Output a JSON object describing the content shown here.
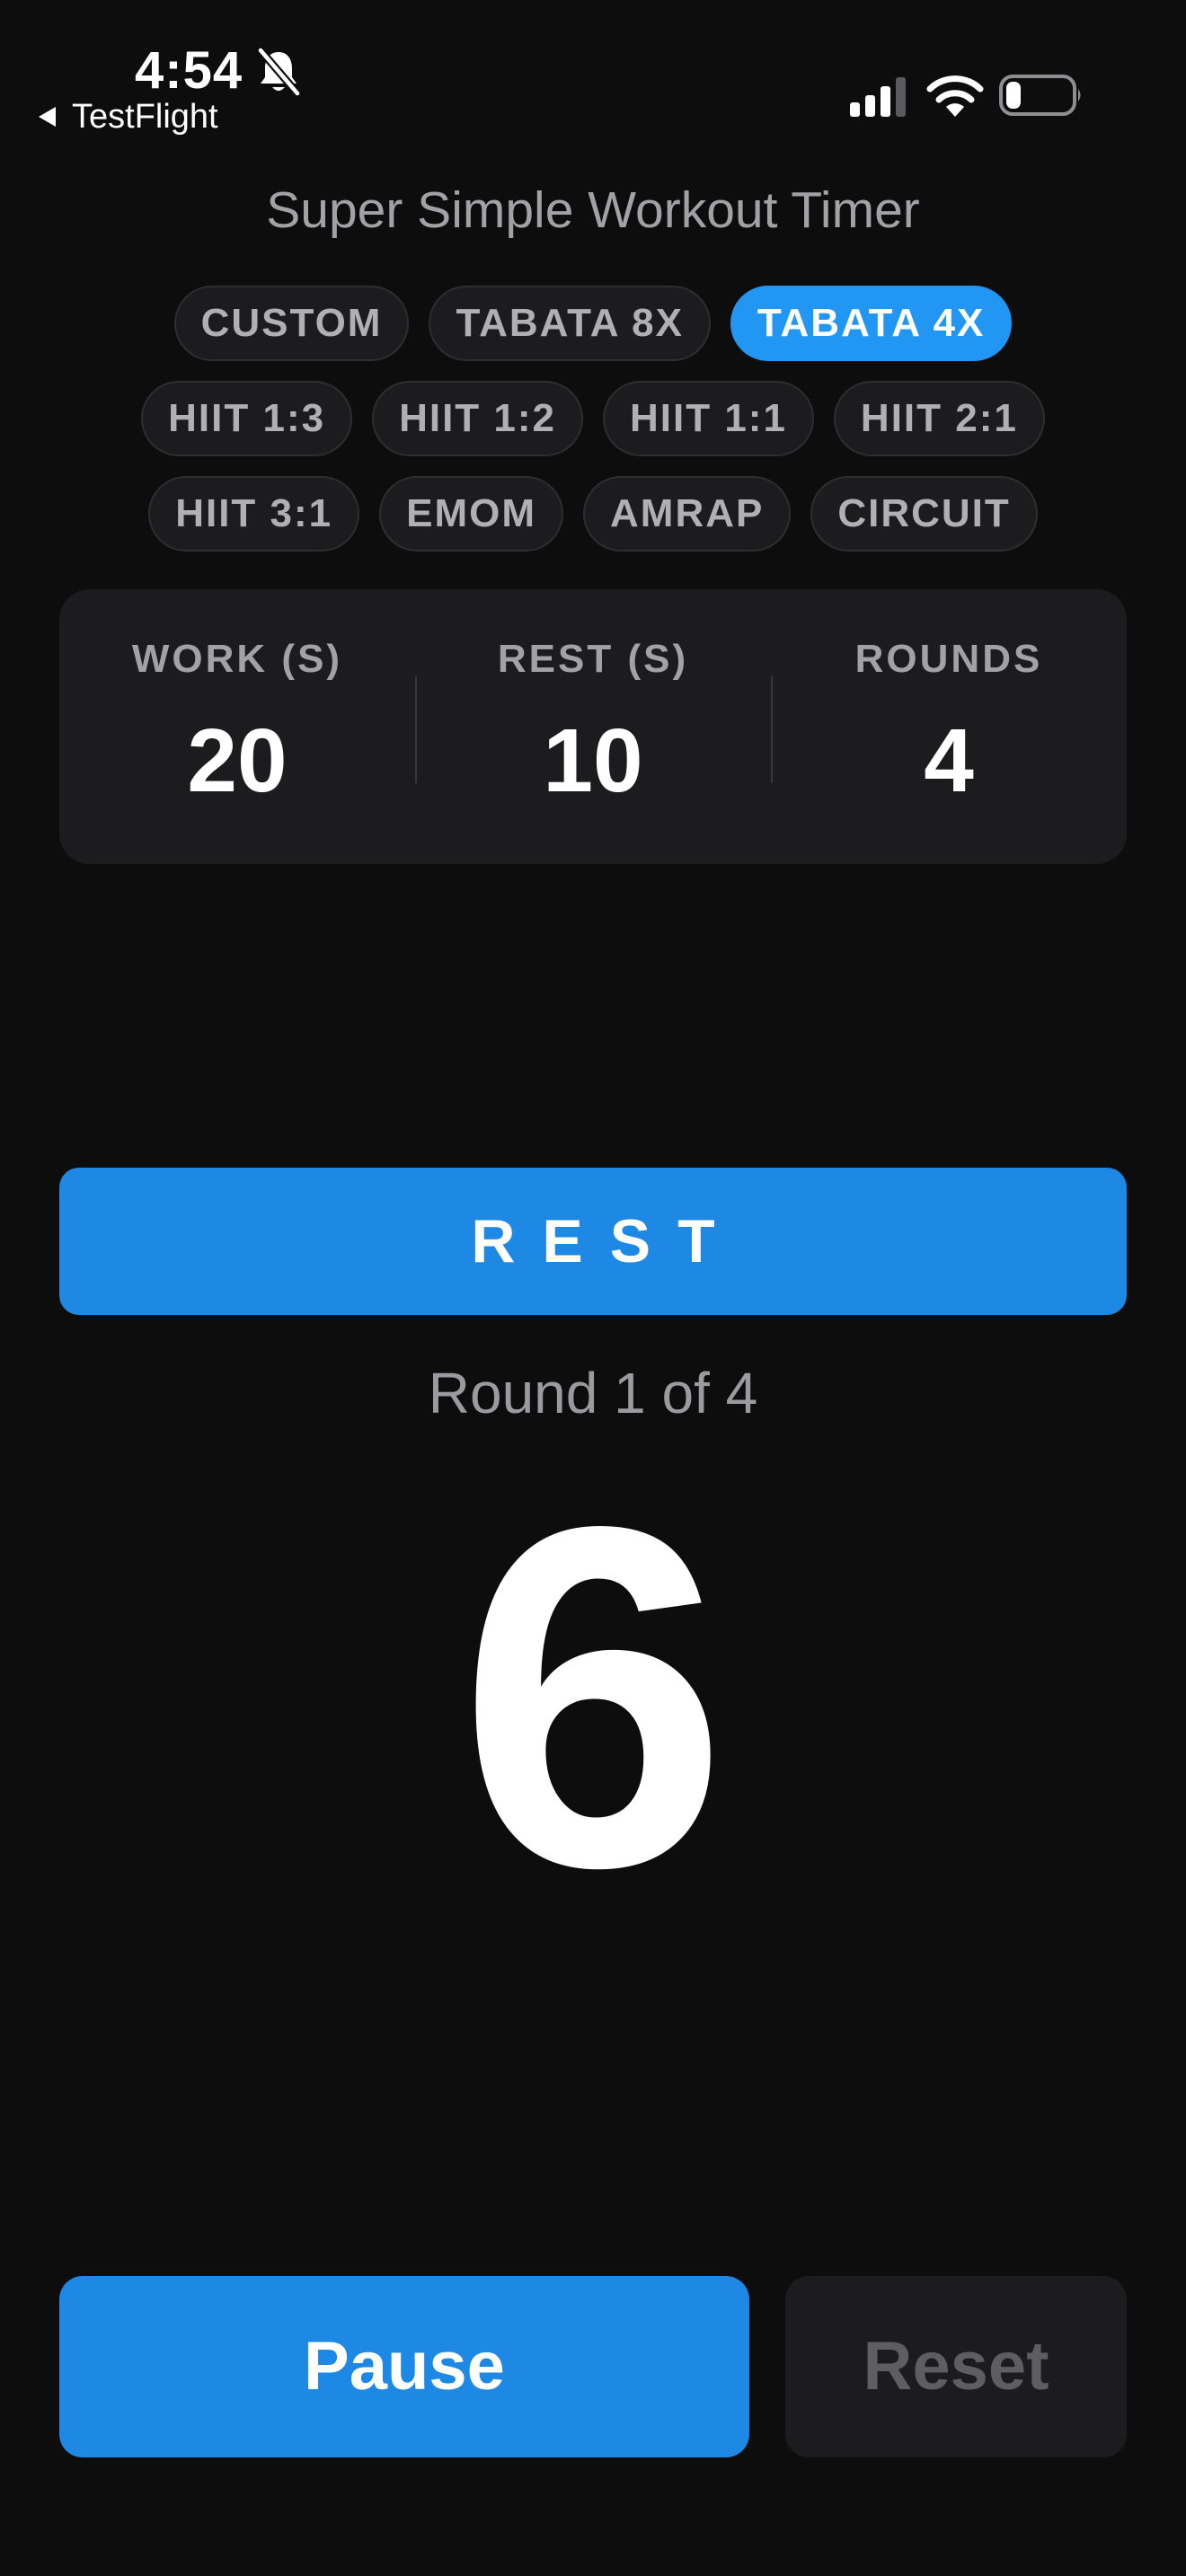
{
  "status_bar": {
    "time": "4:54",
    "back_label": "TestFlight",
    "icons": [
      "bell-slash-icon",
      "cellular-signal-icon",
      "wifi-icon",
      "battery-icon"
    ],
    "battery_level": 0.2
  },
  "app": {
    "title": "Super Simple Workout Timer"
  },
  "presets": {
    "active": "TABATA 4X",
    "active_color": "#2196f3",
    "row1": [
      "CUSTOM",
      "TABATA 8X",
      "TABATA 4X"
    ],
    "row2": [
      "HIIT 1:3",
      "HIIT 1:2",
      "HIIT 1:1",
      "HIIT 2:1"
    ],
    "row3": [
      "HIIT 3:1",
      "EMOM",
      "AMRAP",
      "CIRCUIT"
    ]
  },
  "settings": {
    "work_label": "WORK (S)",
    "work_value": "20",
    "rest_label": "REST (S)",
    "rest_value": "10",
    "rounds_label": "ROUNDS",
    "rounds_value": "4"
  },
  "timer": {
    "phase": "REST",
    "phase_color": "#1e88e5",
    "round_text": "Round 1 of 4",
    "countdown": "6"
  },
  "controls": {
    "pause_label": "Pause",
    "reset_label": "Reset"
  }
}
